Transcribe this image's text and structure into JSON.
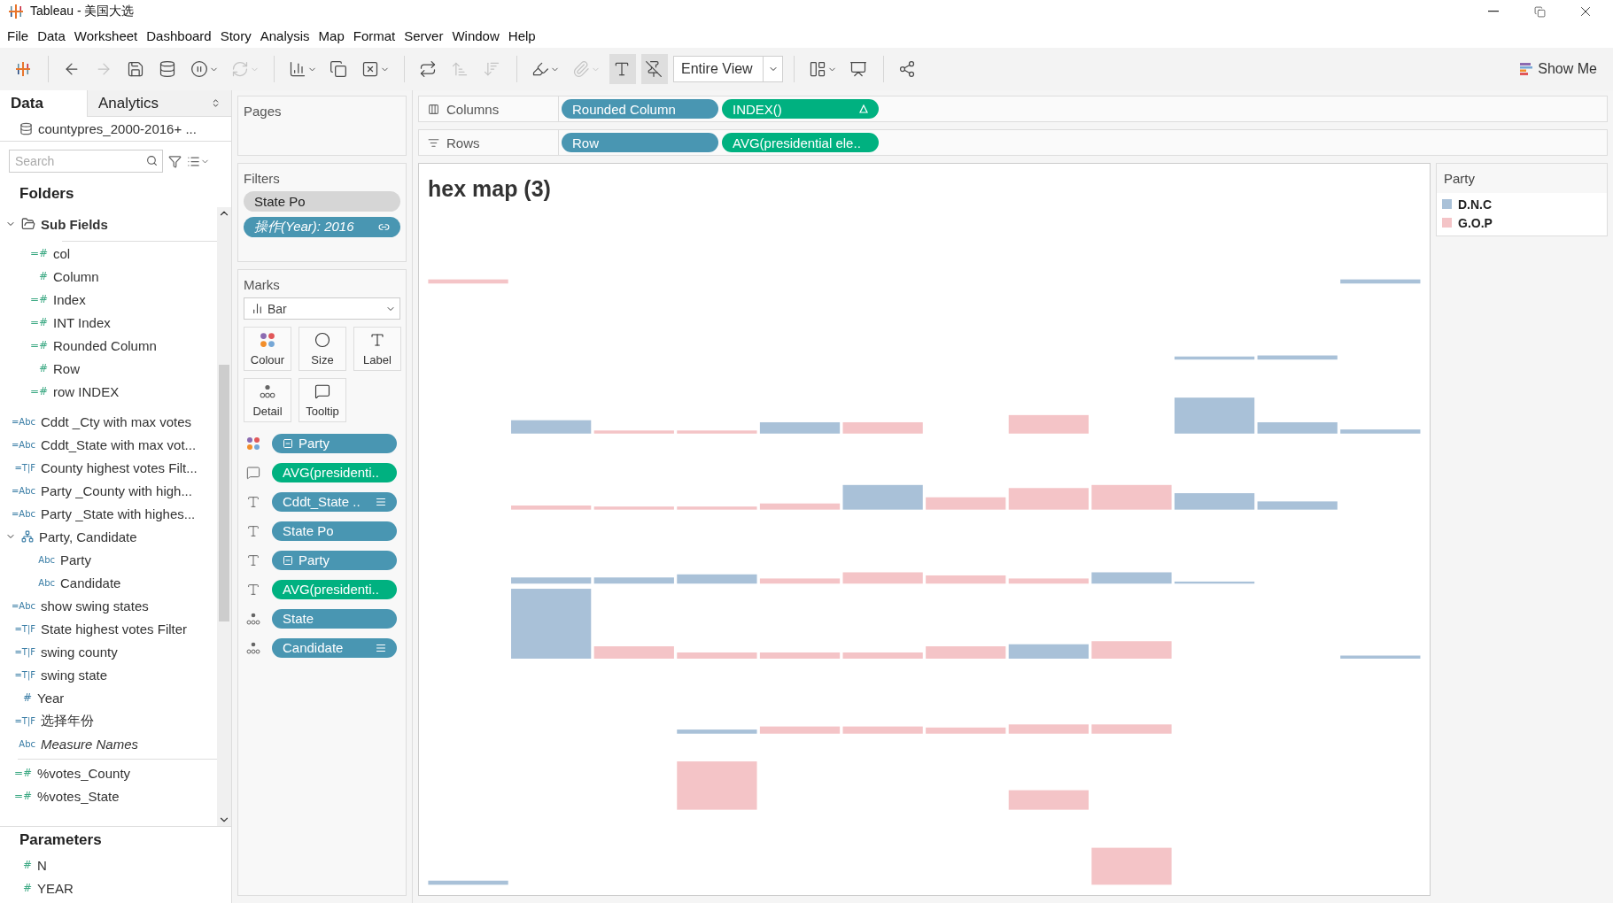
{
  "window": {
    "title": "Tableau - 美国大选"
  },
  "menu": [
    "File",
    "Data",
    "Worksheet",
    "Dashboard",
    "Story",
    "Analysis",
    "Map",
    "Format",
    "Server",
    "Window",
    "Help"
  ],
  "toolbar": {
    "items": [
      {
        "kind": "logo"
      },
      {
        "kind": "separator"
      },
      {
        "kind": "back",
        "disabled": false,
        "dropdown": false,
        "on": false
      },
      {
        "kind": "forward",
        "disabled": true,
        "dropdown": false,
        "on": false
      },
      {
        "kind": "save",
        "disabled": false,
        "dropdown": false,
        "on": false
      },
      {
        "kind": "new-datasource",
        "disabled": false,
        "dropdown": false,
        "on": false
      },
      {
        "kind": "pause",
        "disabled": false,
        "dropdown": true,
        "on": false
      },
      {
        "kind": "refresh",
        "disabled": true,
        "dropdown": true,
        "on": false
      },
      {
        "kind": "separator"
      },
      {
        "kind": "new-sheet",
        "disabled": false,
        "dropdown": true,
        "on": false
      },
      {
        "kind": "duplicate",
        "disabled": false,
        "dropdown": false,
        "on": false
      },
      {
        "kind": "clear",
        "disabled": false,
        "dropdown": true,
        "on": false
      },
      {
        "kind": "separator"
      },
      {
        "kind": "swap",
        "disabled": false,
        "dropdown": false,
        "on": false
      },
      {
        "kind": "sort-asc",
        "disabled": true,
        "dropdown": false,
        "on": false
      },
      {
        "kind": "sort-desc",
        "disabled": true,
        "dropdown": false,
        "on": false
      },
      {
        "kind": "separator"
      },
      {
        "kind": "highlight",
        "disabled": false,
        "dropdown": true,
        "on": false
      },
      {
        "kind": "group",
        "disabled": true,
        "dropdown": true,
        "on": false
      },
      {
        "kind": "labels",
        "disabled": false,
        "dropdown": false,
        "on": true
      },
      {
        "kind": "pin",
        "disabled": false,
        "dropdown": false,
        "on": true
      },
      {
        "kind": "view-select",
        "label": "Entire View"
      },
      {
        "kind": "separator"
      },
      {
        "kind": "show-cards",
        "disabled": false,
        "dropdown": true,
        "on": false
      },
      {
        "kind": "presentation",
        "disabled": false,
        "dropdown": false,
        "on": false
      },
      {
        "kind": "separator"
      },
      {
        "kind": "share",
        "disabled": false,
        "dropdown": false,
        "on": false
      }
    ],
    "show_me": "Show Me"
  },
  "data_pane": {
    "tabs": [
      {
        "label": "Data",
        "selected": true
      },
      {
        "label": "Analytics",
        "selected": false
      }
    ],
    "datasource": "countypres_2000-2016+ ...",
    "search": {
      "placeholder": "Search"
    },
    "folders_heading": "Folders",
    "sections": [
      [
        {
          "kind": "folder",
          "label": "Sub Fields",
          "expanded": true,
          "children": [
            {
              "kind": "measure",
              "icon": "=#",
              "label": "col"
            },
            {
              "kind": "measure",
              "icon": "#",
              "label": "Column"
            },
            {
              "kind": "measure",
              "icon": "=#",
              "label": "Index"
            },
            {
              "kind": "measure",
              "icon": "=#",
              "label": "INT Index"
            },
            {
              "kind": "measure",
              "icon": "=#",
              "label": "Rounded Column"
            },
            {
              "kind": "measure",
              "icon": "#",
              "label": "Row"
            },
            {
              "kind": "measure",
              "icon": "=#",
              "label": "row INDEX"
            }
          ]
        }
      ],
      [
        {
          "kind": "dimension",
          "icon": "=Abc",
          "label": "Cddt _Cty with max votes"
        },
        {
          "kind": "dimension",
          "icon": "=Abc",
          "label": "Cddt_State with max vot..."
        },
        {
          "kind": "dimension",
          "icon": "=T|F",
          "label": "County highest votes Filt..."
        },
        {
          "kind": "dimension",
          "icon": "=Abc",
          "label": "Party _County with high..."
        },
        {
          "kind": "dimension",
          "icon": "=Abc",
          "label": "Party _State with highes..."
        },
        {
          "kind": "hierarchy",
          "label": "Party, Candidate",
          "expanded": true,
          "children": [
            {
              "kind": "dimension",
              "icon": "Abc",
              "label": "Party"
            },
            {
              "kind": "dimension",
              "icon": "Abc",
              "label": "Candidate"
            }
          ]
        },
        {
          "kind": "dimension",
          "icon": "=Abc",
          "label": "show swing states"
        },
        {
          "kind": "dimension",
          "icon": "=T|F",
          "label": "State highest votes Filter"
        },
        {
          "kind": "dimension",
          "icon": "=T|F",
          "label": "swing county"
        },
        {
          "kind": "dimension",
          "icon": "=T|F",
          "label": "swing state"
        },
        {
          "kind": "dimension",
          "icon": "#",
          "label": "Year"
        },
        {
          "kind": "dimension",
          "icon": "=T|F",
          "label": "选择年份"
        },
        {
          "kind": "generated",
          "icon": "Abc",
          "label": "Measure Names"
        }
      ],
      [
        {
          "kind": "measure",
          "icon": "=#",
          "label": "%votes_County"
        },
        {
          "kind": "measure",
          "icon": "=#",
          "label": "%votes_State"
        }
      ]
    ],
    "parameters_heading": "Parameters",
    "parameters": [
      {
        "icon": "#",
        "label": "N"
      },
      {
        "icon": "#",
        "label": "YEAR"
      }
    ]
  },
  "pages": {
    "title": "Pages"
  },
  "filters": {
    "title": "Filters",
    "pills": [
      {
        "kind": "plain",
        "label": "State Po"
      },
      {
        "kind": "context",
        "label": "操作(Year): 2016"
      }
    ]
  },
  "marks": {
    "title": "Marks",
    "mark_type": "Bar",
    "cards": [
      {
        "kind": "color",
        "label": "Colour"
      },
      {
        "kind": "size",
        "label": "Size"
      },
      {
        "kind": "label",
        "label": "Label"
      },
      {
        "kind": "detail",
        "label": "Detail"
      },
      {
        "kind": "tooltip",
        "label": "Tooltip"
      }
    ],
    "pills": [
      {
        "kind": "color",
        "color": "#4996b2",
        "label": "Party",
        "collapse": true,
        "sorted": false
      },
      {
        "kind": "tooltip",
        "color": "#00b180",
        "label": "AVG(presidenti..",
        "collapse": false,
        "sorted": false
      },
      {
        "kind": "label",
        "color": "#4996b2",
        "label": "Cddt_State ..",
        "collapse": false,
        "sorted": true
      },
      {
        "kind": "label",
        "color": "#4996b2",
        "label": "State Po",
        "collapse": false,
        "sorted": false
      },
      {
        "kind": "label",
        "color": "#4996b2",
        "label": "Party",
        "collapse": true,
        "sorted": false
      },
      {
        "kind": "label",
        "color": "#00b180",
        "label": "AVG(presidenti..",
        "collapse": false,
        "sorted": false
      },
      {
        "kind": "detail",
        "color": "#4996b2",
        "label": "State",
        "collapse": false,
        "sorted": false
      },
      {
        "kind": "detail",
        "color": "#4996b2",
        "label": "Candidate",
        "collapse": false,
        "sorted": true
      }
    ]
  },
  "shelves": [
    {
      "kind": "columns",
      "label": "Columns",
      "pills": [
        {
          "color": "#4996b2",
          "label": "Rounded Column",
          "table_calc": false
        },
        {
          "color": "#00b180",
          "label": "INDEX()",
          "table_calc": true
        }
      ]
    },
    {
      "kind": "rows",
      "label": "Rows",
      "pills": [
        {
          "color": "#4996b2",
          "label": "Row",
          "table_calc": false
        },
        {
          "color": "#00b180",
          "label": "AVG(presidential ele..",
          "table_calc": false
        }
      ]
    }
  ],
  "view": {
    "title": "hex map (3)"
  },
  "legend": {
    "title": "Party",
    "items": [
      {
        "label": "D.N.C",
        "color": "#a9c1d8"
      },
      {
        "label": "G.O.P",
        "color": "#f4c4c7"
      }
    ]
  }
}
